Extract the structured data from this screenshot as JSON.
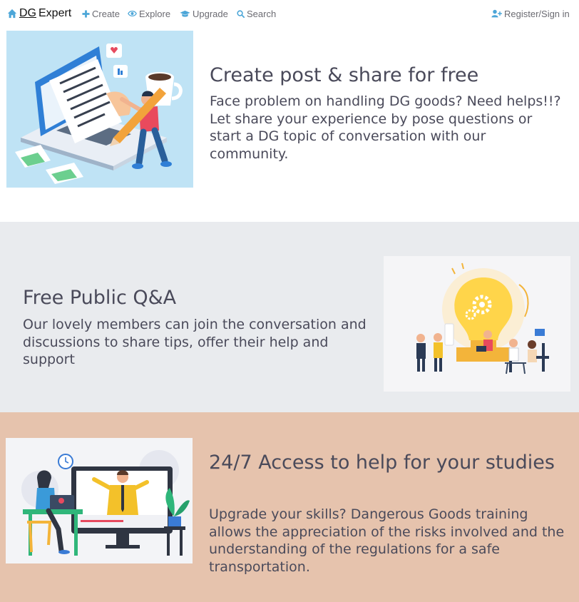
{
  "nav": {
    "brand_part1": "DG",
    "brand_part2": "Expert",
    "brand_icon": "home-icon",
    "items": [
      {
        "label": "Create",
        "icon": "plus-icon"
      },
      {
        "label": "Explore",
        "icon": "eye-icon"
      },
      {
        "label": "Upgrade",
        "icon": "graduation-cap-icon"
      },
      {
        "label": "Search",
        "icon": "search-icon"
      }
    ],
    "register": {
      "label": "Register/Sign in",
      "icon": "user-plus-icon"
    },
    "accent_color": "#4ca6d8"
  },
  "sections": [
    {
      "title": "Create post & share for free",
      "description": "Face problem on handling DG goods? Need helps!!? Let share your experience by pose questions or start a DG topic of conversation with our community.",
      "background": "#ffffff",
      "illustration": "person-writing-document-on-laptop-illustration"
    },
    {
      "title": "Free Public Q&A",
      "description": "Our lovely members can join the conversation and discussions to share tips, offer their help and support",
      "background": "#e9ebee",
      "illustration": "team-lightbulb-ideas-illustration"
    },
    {
      "title": "24/7 Access to help for your studies",
      "description": "Upgrade your skills? Dangerous Goods training allows the appreciation of the risks involved and the understanding of the regulations for a safe transportation.",
      "background": "#e6c3ad",
      "illustration": "online-video-lesson-illustration"
    }
  ]
}
